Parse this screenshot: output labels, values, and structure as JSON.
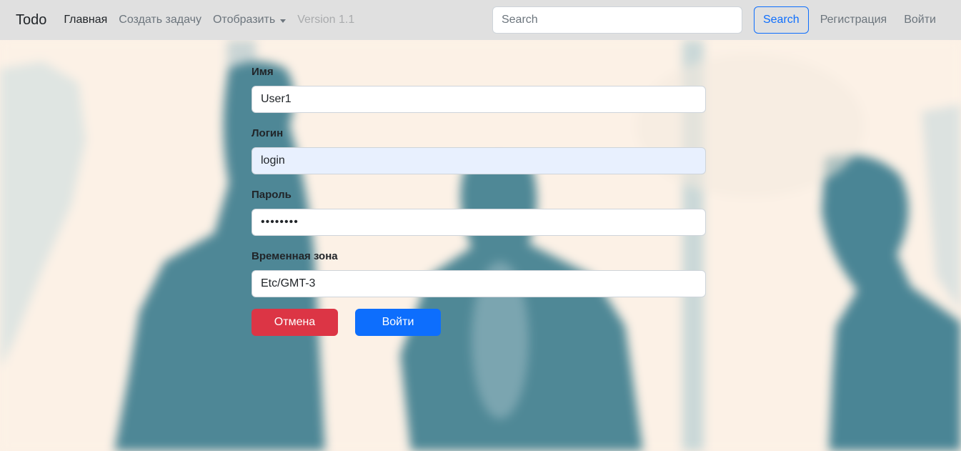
{
  "navbar": {
    "brand": "Todo",
    "links": {
      "home": "Главная",
      "create_task": "Создать задачу",
      "display": "Отобразить",
      "version": "Version 1.1"
    },
    "search_placeholder": "Search",
    "search_button": "Search",
    "register": "Регистрация",
    "login": "Войти"
  },
  "form": {
    "name": {
      "label": "Имя",
      "value": "User1"
    },
    "login": {
      "label": "Логин",
      "value": "login"
    },
    "password": {
      "label": "Пароль",
      "value": "12345678"
    },
    "timezone": {
      "label": "Временная зона",
      "value": "Etc/GMT-3"
    },
    "cancel_button": "Отмена",
    "submit_button": "Войти"
  },
  "colors": {
    "navbar_bg": "#e0e0e0",
    "primary": "#0d6efd",
    "danger": "#dc3545",
    "page_bg": "#fcf1e6",
    "figure": "#4e8796"
  }
}
